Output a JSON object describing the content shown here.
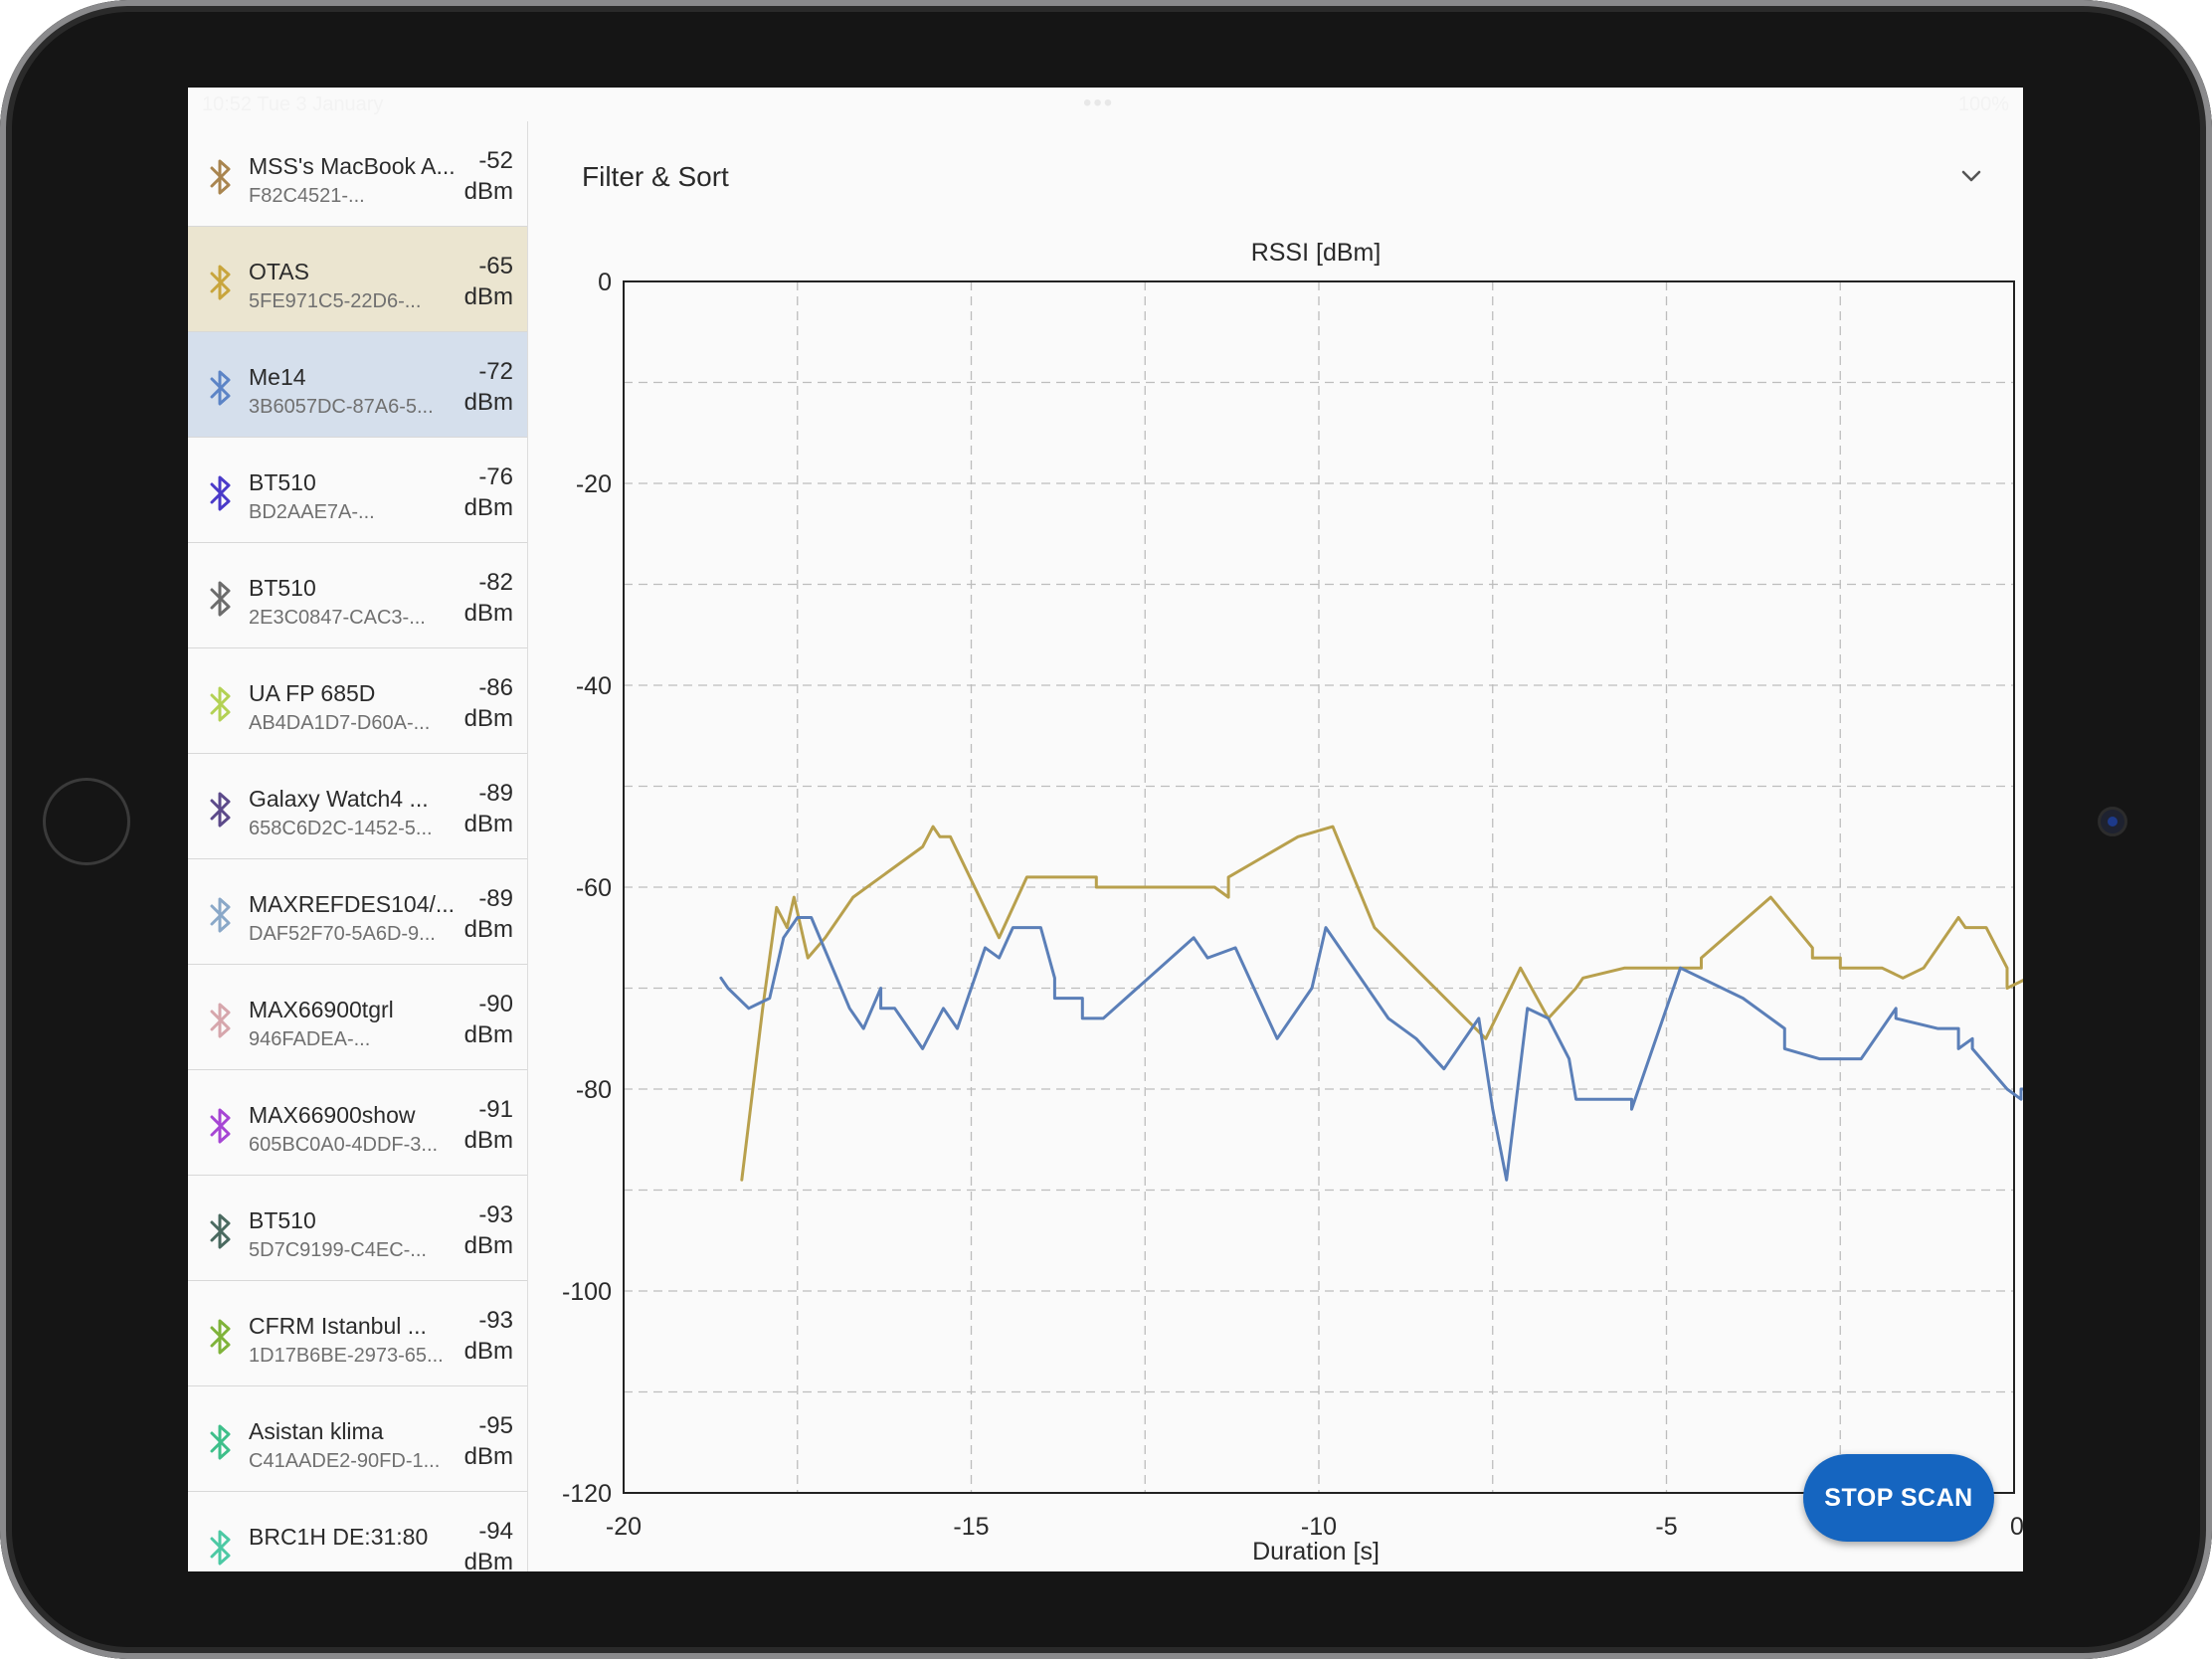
{
  "statusbar": {
    "time": "10:52 Tue 3 January",
    "dots": "•••",
    "right": "100%"
  },
  "filter": {
    "label": "Filter & Sort"
  },
  "stop_button": {
    "label": "STOP SCAN"
  },
  "devices": [
    {
      "name": "MSS's MacBook A...",
      "uuid": "F82C4521-...",
      "rssi": "-52",
      "unit": "dBm",
      "color": "#a9854f"
    },
    {
      "name": "OTAS",
      "uuid": "5FE971C5-22D6-...",
      "rssi": "-65",
      "unit": "dBm",
      "color": "#c8a53c"
    },
    {
      "name": "Me14",
      "uuid": "3B6057DC-87A6-5...",
      "rssi": "-72",
      "unit": "dBm",
      "color": "#5c84c6"
    },
    {
      "name": "BT510",
      "uuid": "BD2AAE7A-...",
      "rssi": "-76",
      "unit": "dBm",
      "color": "#4a3ac9"
    },
    {
      "name": "BT510",
      "uuid": "2E3C0847-CAC3-...",
      "rssi": "-82",
      "unit": "dBm",
      "color": "#6c6c6c"
    },
    {
      "name": "UA FP 685D",
      "uuid": "AB4DA1D7-D60A-...",
      "rssi": "-86",
      "unit": "dBm",
      "color": "#b3d154"
    },
    {
      "name": "Galaxy Watch4 ...",
      "uuid": "658C6D2C-1452-5...",
      "rssi": "-89",
      "unit": "dBm",
      "color": "#5c4a8a"
    },
    {
      "name": "MAXREFDES104/...",
      "uuid": "DAF52F70-5A6D-9...",
      "rssi": "-89",
      "unit": "dBm",
      "color": "#8aa8c8"
    },
    {
      "name": "MAX66900tgrl",
      "uuid": "946FADEA-...",
      "rssi": "-90",
      "unit": "dBm",
      "color": "#d6a6ac"
    },
    {
      "name": "MAX66900show",
      "uuid": "605BC0A0-4DDF-3...",
      "rssi": "-91",
      "unit": "dBm",
      "color": "#a646d4"
    },
    {
      "name": "BT510",
      "uuid": "5D7C9199-C4EC-...",
      "rssi": "-93",
      "unit": "dBm",
      "color": "#4a6a60"
    },
    {
      "name": "CFRM Istanbul ...",
      "uuid": "1D17B6BE-2973-65...",
      "rssi": "-93",
      "unit": "dBm",
      "color": "#7fb33a"
    },
    {
      "name": "Asistan klima",
      "uuid": "C41AADE2-90FD-1...",
      "rssi": "-95",
      "unit": "dBm",
      "color": "#3ebf8a"
    },
    {
      "name": "BRC1H DE:31:80",
      "uuid": "",
      "rssi": "-94",
      "unit": "dBm",
      "color": "#4cc9a4"
    }
  ],
  "chart_data": {
    "type": "line",
    "title": "RSSI [dBm]",
    "xlabel": "Duration [s]",
    "ylabel": "",
    "xlim": [
      -20,
      0
    ],
    "ylim": [
      -120,
      0
    ],
    "xticks": [
      -20,
      -15,
      -10,
      -5,
      0
    ],
    "yticks": [
      0,
      -20,
      -40,
      -60,
      -80,
      -100,
      -120
    ],
    "grid": true,
    "series": [
      {
        "color": "#b8a04d",
        "points": [
          [
            -18.3,
            -89
          ],
          [
            -18.0,
            -72
          ],
          [
            -17.8,
            -62
          ],
          [
            -17.65,
            -64
          ],
          [
            -17.55,
            -61
          ],
          [
            -17.35,
            -67
          ],
          [
            -17.1,
            -65
          ],
          [
            -16.7,
            -61
          ],
          [
            -15.7,
            -56
          ],
          [
            -15.55,
            -54
          ],
          [
            -15.45,
            -55
          ],
          [
            -15.3,
            -55
          ],
          [
            -14.6,
            -65
          ],
          [
            -14.2,
            -59
          ],
          [
            -13.2,
            -59
          ],
          [
            -13.2,
            -60
          ],
          [
            -11.5,
            -60
          ],
          [
            -11.3,
            -61
          ],
          [
            -11.3,
            -59
          ],
          [
            -10.3,
            -55
          ],
          [
            -9.8,
            -54
          ],
          [
            -9.2,
            -64
          ],
          [
            -7.6,
            -75
          ],
          [
            -7.1,
            -68
          ],
          [
            -6.7,
            -73
          ],
          [
            -6.3,
            -70
          ],
          [
            -6.2,
            -69
          ],
          [
            -5.6,
            -68
          ],
          [
            -4.5,
            -68
          ],
          [
            -4.5,
            -67
          ],
          [
            -3.5,
            -61
          ],
          [
            -2.9,
            -66
          ],
          [
            -2.9,
            -67
          ],
          [
            -2.5,
            -67
          ],
          [
            -2.5,
            -68
          ],
          [
            -1.9,
            -68
          ],
          [
            -1.6,
            -69
          ],
          [
            -1.3,
            -68
          ],
          [
            -0.8,
            -63
          ],
          [
            -0.7,
            -64
          ],
          [
            -0.4,
            -64
          ],
          [
            -0.1,
            -68
          ],
          [
            -0.1,
            -70
          ],
          [
            0.2,
            -69
          ],
          [
            0.5,
            -68
          ]
        ]
      },
      {
        "color": "#5b7fb8",
        "points": [
          [
            -18.6,
            -69
          ],
          [
            -18.5,
            -70
          ],
          [
            -18.2,
            -72
          ],
          [
            -17.9,
            -71
          ],
          [
            -17.7,
            -65
          ],
          [
            -17.5,
            -63
          ],
          [
            -17.3,
            -63
          ],
          [
            -16.75,
            -72
          ],
          [
            -16.55,
            -74
          ],
          [
            -16.3,
            -70
          ],
          [
            -16.3,
            -72
          ],
          [
            -16.1,
            -72
          ],
          [
            -15.7,
            -76
          ],
          [
            -15.4,
            -72
          ],
          [
            -15.2,
            -74
          ],
          [
            -14.8,
            -66
          ],
          [
            -14.6,
            -67
          ],
          [
            -14.4,
            -64
          ],
          [
            -14.0,
            -64
          ],
          [
            -13.8,
            -69
          ],
          [
            -13.8,
            -71
          ],
          [
            -13.4,
            -71
          ],
          [
            -13.4,
            -73
          ],
          [
            -13.1,
            -73
          ],
          [
            -11.8,
            -65
          ],
          [
            -11.6,
            -67
          ],
          [
            -11.2,
            -66
          ],
          [
            -10.6,
            -75
          ],
          [
            -10.1,
            -70
          ],
          [
            -9.9,
            -64
          ],
          [
            -9.0,
            -73
          ],
          [
            -8.6,
            -75
          ],
          [
            -8.2,
            -78
          ],
          [
            -7.7,
            -73
          ],
          [
            -7.5,
            -82
          ],
          [
            -7.3,
            -89
          ],
          [
            -7.0,
            -72
          ],
          [
            -6.7,
            -73
          ],
          [
            -6.4,
            -77
          ],
          [
            -6.3,
            -81
          ],
          [
            -5.5,
            -81
          ],
          [
            -5.5,
            -82
          ],
          [
            -4.8,
            -68
          ],
          [
            -3.9,
            -71
          ],
          [
            -3.3,
            -74
          ],
          [
            -3.3,
            -76
          ],
          [
            -2.8,
            -77
          ],
          [
            -2.2,
            -77
          ],
          [
            -1.7,
            -72
          ],
          [
            -1.7,
            -73
          ],
          [
            -1.1,
            -74
          ],
          [
            -0.8,
            -74
          ],
          [
            -0.8,
            -76
          ],
          [
            -0.6,
            -75
          ],
          [
            -0.6,
            -76
          ],
          [
            -0.1,
            -80
          ],
          [
            0.1,
            -81
          ],
          [
            0.1,
            -80
          ],
          [
            0.4,
            -80
          ],
          [
            0.4,
            -79
          ]
        ]
      }
    ]
  }
}
